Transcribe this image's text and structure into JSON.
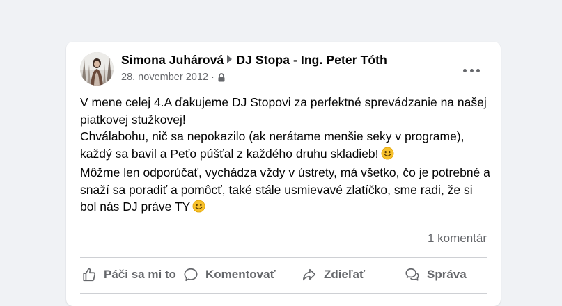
{
  "post": {
    "author": "Simona Juhárová",
    "target": "DJ Stopa - Ing. Peter Tóth",
    "date": "28. november 2012",
    "separator": "·",
    "privacy_icon": "lock-icon",
    "more_icon": "more-dots-icon",
    "text_lines": [
      "V mene celej 4.A ďakujeme DJ Stopovi za perfektné sprevádzanie na našej piatkovej stužkovej!",
      "Chválabohu, nič sa nepokazilo (ak nerátame menšie seky v programe), každý sa bavil a Peťo púšťal z každého druhu skladieb!",
      "Môžme len odporúčať, vychádza vždy v ústrety, má všetko, čo je potrebné a snaží sa poradiť a pomôcť, také stále usmievavé zlatíčko, sme radi, že si bol nás DJ práve TY"
    ],
    "emoji": "smiley-emoji",
    "comment_count": "1 komentár"
  },
  "actions": {
    "like": "Páči sa mi to",
    "comment": "Komentovať",
    "share": "Zdieľať",
    "message": "Správa"
  },
  "colors": {
    "background": "#f0f2f5",
    "card": "#ffffff",
    "secondary_text": "#65676b",
    "primary_text": "#050505",
    "divider": "#ced0d4"
  }
}
